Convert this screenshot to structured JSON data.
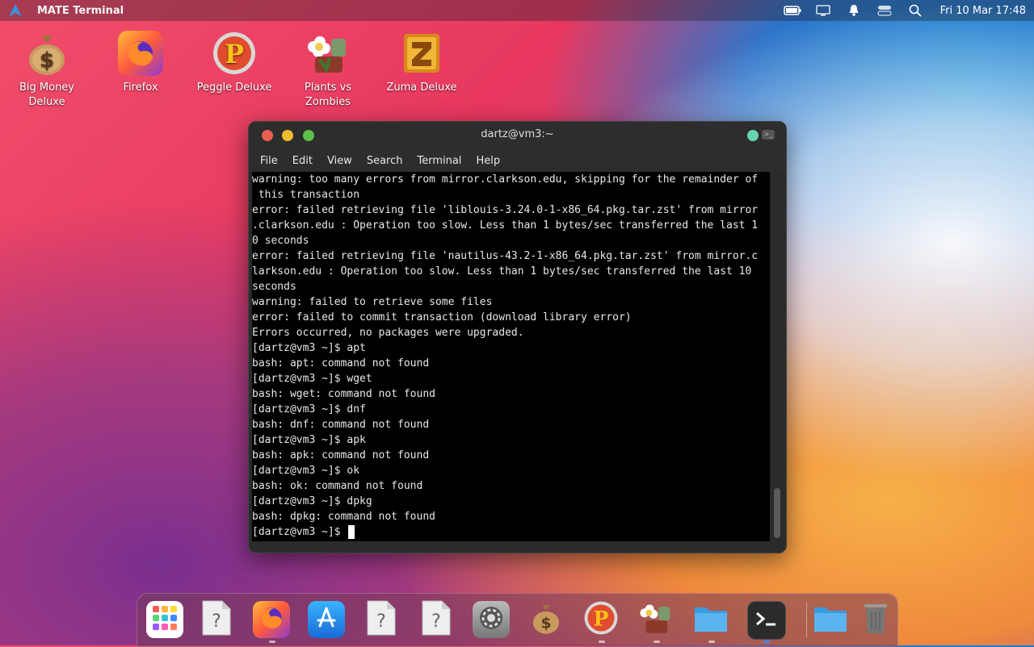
{
  "top_panel": {
    "app_title": "MATE Terminal",
    "clock": "Fri 10 Mar 17:48",
    "tray_icons": [
      "battery-icon",
      "display-icon",
      "notification-icon",
      "toggle-icon",
      "search-icon"
    ]
  },
  "desktop": {
    "icons": [
      {
        "label": "Big Money Deluxe",
        "icon": "money-bag-icon"
      },
      {
        "label": "Firefox",
        "icon": "firefox-icon"
      },
      {
        "label": "Peggle Deluxe",
        "icon": "peggle-icon"
      },
      {
        "label": "Plants vs Zombies",
        "icon": "plants-vs-zombies-icon"
      },
      {
        "label": "Zuma Deluxe",
        "icon": "zuma-icon"
      }
    ]
  },
  "window": {
    "title": "dartz@vm3:~",
    "menu": [
      "File",
      "Edit",
      "View",
      "Search",
      "Terminal",
      "Help"
    ],
    "lines": [
      "warning: too many errors from mirror.clarkson.edu, skipping for the remainder of",
      " this transaction",
      "error: failed retrieving file 'liblouis-3.24.0-1-x86_64.pkg.tar.zst' from mirror",
      ".clarkson.edu : Operation too slow. Less than 1 bytes/sec transferred the last 1",
      "0 seconds",
      "error: failed retrieving file 'nautilus-43.2-1-x86_64.pkg.tar.zst' from mirror.c",
      "larkson.edu : Operation too slow. Less than 1 bytes/sec transferred the last 10",
      "seconds",
      "warning: failed to retrieve some files",
      "error: failed to commit transaction (download library error)",
      "Errors occurred, no packages were upgraded.",
      "[dartz@vm3 ~]$ apt",
      "bash: apt: command not found",
      "[dartz@vm3 ~]$ wget",
      "bash: wget: command not found",
      "[dartz@vm3 ~]$ dnf",
      "bash: dnf: command not found",
      "[dartz@vm3 ~]$ apk",
      "bash: apk: command not found",
      "[dartz@vm3 ~]$ ok",
      "bash: ok: command not found",
      "[dartz@vm3 ~]$ dpkg",
      "bash: dpkg: command not found"
    ],
    "prompt": "[dartz@vm3 ~]$ "
  },
  "dock": {
    "items": [
      {
        "icon": "app-grid-icon"
      },
      {
        "icon": "unknown-file-icon"
      },
      {
        "icon": "firefox-icon"
      },
      {
        "icon": "app-store-icon"
      },
      {
        "icon": "unknown-file-icon"
      },
      {
        "icon": "unknown-file-icon"
      },
      {
        "icon": "settings-icon"
      },
      {
        "icon": "money-bag-icon"
      },
      {
        "icon": "peggle-icon"
      },
      {
        "icon": "plants-vs-zombies-icon"
      },
      {
        "icon": "folder-icon"
      },
      {
        "icon": "terminal-icon"
      },
      {
        "icon": "folder-icon"
      },
      {
        "icon": "trash-icon"
      }
    ]
  }
}
